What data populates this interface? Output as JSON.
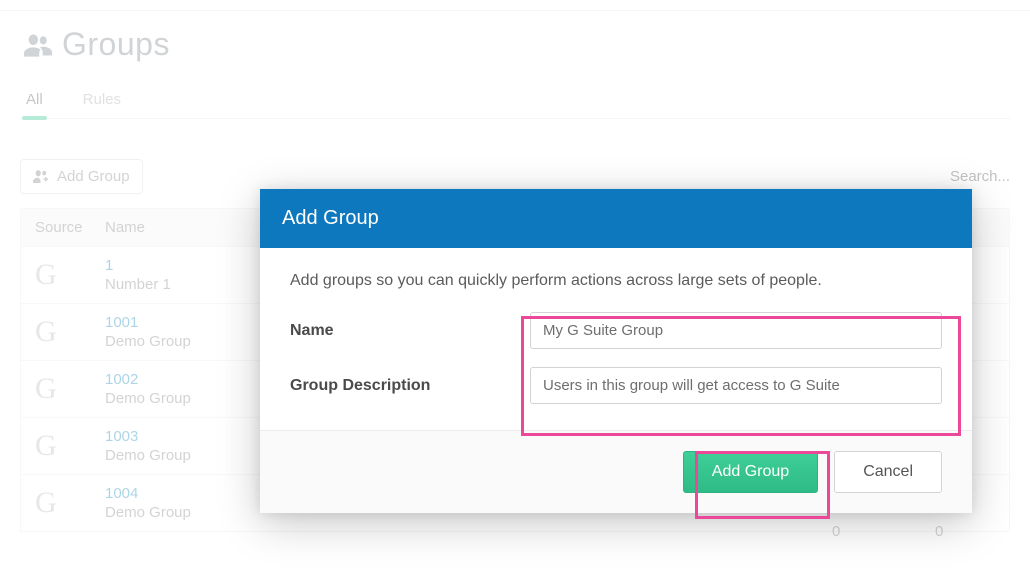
{
  "page": {
    "title": "Groups"
  },
  "tabs": {
    "all": "All",
    "rules": "Rules"
  },
  "toolbar": {
    "add_group": "Add Group",
    "search_placeholder": "Search..."
  },
  "table": {
    "headers": {
      "source": "Source",
      "name": "Name"
    },
    "rows": [
      {
        "source_letter": "G",
        "id": "1",
        "subtitle": "Number 1"
      },
      {
        "source_letter": "G",
        "id": "1001",
        "subtitle": "Demo Group"
      },
      {
        "source_letter": "G",
        "id": "1002",
        "subtitle": "Demo Group"
      },
      {
        "source_letter": "G",
        "id": "1003",
        "subtitle": "Demo Group"
      },
      {
        "source_letter": "G",
        "id": "1004",
        "subtitle": "Demo Group"
      }
    ]
  },
  "modal": {
    "title": "Add Group",
    "description": "Add groups so you can quickly perform actions across large sets of people.",
    "name_label": "Name",
    "name_value": "My G Suite Group",
    "desc_label": "Group Description",
    "desc_value": "Users in this group will get access to G Suite",
    "submit": "Add Group",
    "cancel": "Cancel"
  },
  "trailing": {
    "zero_a": "0",
    "zero_b": "0"
  }
}
